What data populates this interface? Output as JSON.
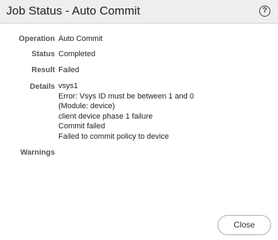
{
  "dialog": {
    "title": "Job Status - Auto Commit",
    "help_icon": "help-circle-icon",
    "help_glyph": "?"
  },
  "fields": {
    "operation": {
      "label": "Operation",
      "value": "Auto Commit"
    },
    "status": {
      "label": "Status",
      "value": "Completed"
    },
    "result": {
      "label": "Result",
      "value": "Failed"
    },
    "details": {
      "label": "Details",
      "lines": [
        "vsys1",
        "Error: Vsys ID must be between 1 and 0",
        "(Module: device)",
        "client device phase 1 failure",
        "Commit failed",
        "Failed to commit policy to device"
      ]
    },
    "warnings": {
      "label": "Warnings",
      "value": ""
    }
  },
  "buttons": {
    "close_label": "Close"
  }
}
